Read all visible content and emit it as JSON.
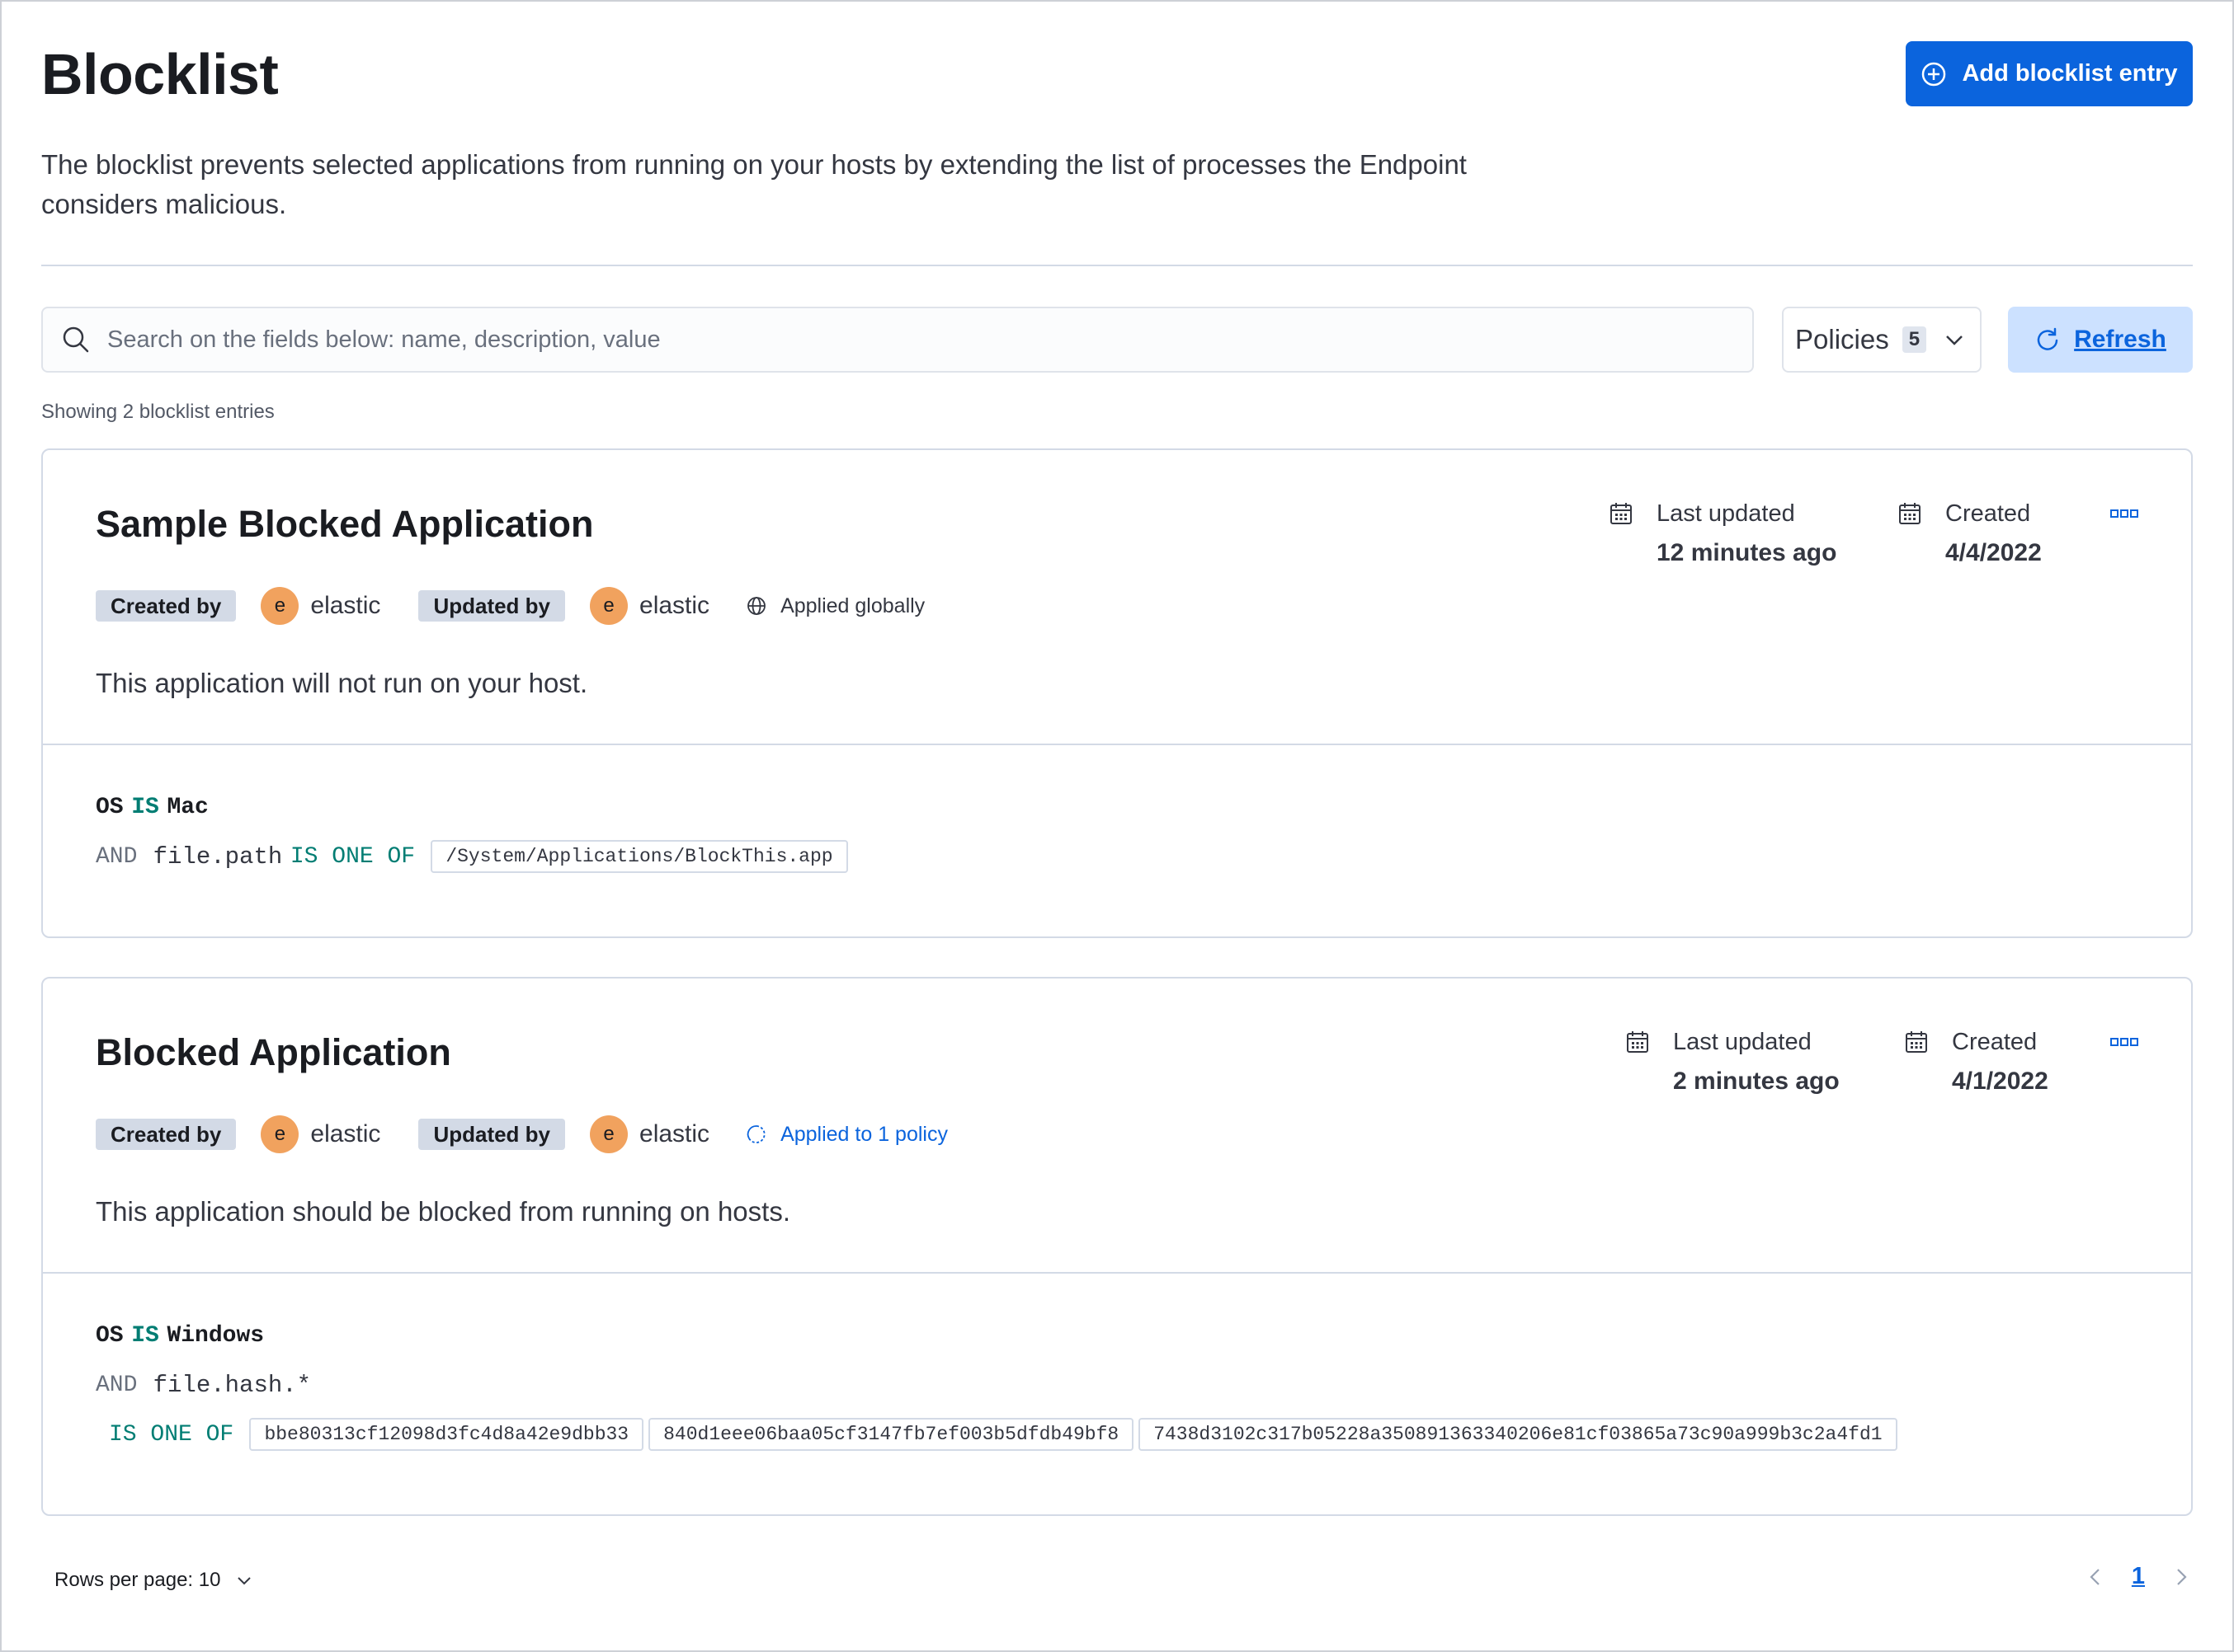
{
  "page": {
    "title": "Blocklist",
    "add_button_label": "Add blocklist entry",
    "description": "The blocklist prevents selected applications from running on your hosts by extending the list of processes the Endpoint considers malicious."
  },
  "toolbar": {
    "search_placeholder": "Search on the fields below: name, description, value",
    "policies_label": "Policies",
    "policies_count": "5",
    "refresh_label": "Refresh"
  },
  "results": {
    "showing_text": "Showing 2 blocklist entries"
  },
  "entries": [
    {
      "name": "Sample Blocked Application",
      "created_by_label": "Created by",
      "created_by_initial": "e",
      "created_by_user": "elastic",
      "updated_by_label": "Updated by",
      "updated_by_initial": "e",
      "updated_by_user": "elastic",
      "applied_text": "Applied globally",
      "applied_icon": "globe-icon",
      "description": "This application will not run on your host.",
      "last_updated_label": "Last updated",
      "last_updated_value": "12 minutes ago",
      "created_label": "Created",
      "created_value": "4/4/2022",
      "condition": {
        "os_kw": "OS",
        "is_kw": "IS",
        "os_value": "Mac",
        "and_kw": "AND",
        "field": "file.path",
        "op": "IS ONE OF",
        "values": [
          "/System/Applications/BlockThis.app"
        ]
      }
    },
    {
      "name": "Blocked Application",
      "created_by_label": "Created by",
      "created_by_initial": "e",
      "created_by_user": "elastic",
      "updated_by_label": "Updated by",
      "updated_by_initial": "e",
      "updated_by_user": "elastic",
      "applied_text": "Applied to 1 policy",
      "applied_icon": "partial-policy-icon",
      "description": "This application should be blocked from running on hosts.",
      "last_updated_label": "Last updated",
      "last_updated_value": "2 minutes ago",
      "created_label": "Created",
      "created_value": "4/1/2022",
      "condition": {
        "os_kw": "OS",
        "is_kw": "IS",
        "os_value": "Windows",
        "and_kw": "AND",
        "field": "file.hash.*",
        "op": "IS ONE OF",
        "values": [
          "bbe80313cf12098d3fc4d8a42e9dbb33",
          "840d1eee06baa05cf3147fb7ef003b5dfdb49bf8",
          "7438d3102c317b05228a350891363340206e81cf03865a73c90a999b3c2a4fd1"
        ]
      }
    }
  ],
  "pagination": {
    "rows_per_page_label": "Rows per page: 10",
    "current_page": "1"
  },
  "colors": {
    "primary": "#0b64dd",
    "operator": "#017d73",
    "avatar": "#f1a25e",
    "badge": "#d3dae6",
    "refresh_bg": "#cce1ff"
  }
}
